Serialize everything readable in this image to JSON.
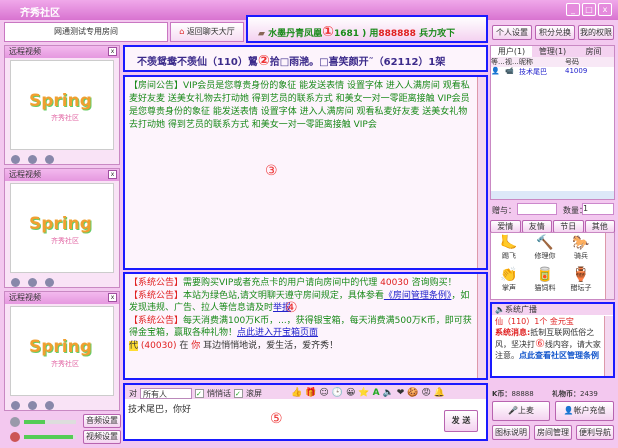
{
  "window": {
    "title": "齐秀社区",
    "min": "_",
    "max": "□",
    "close": "x"
  },
  "tabs": {
    "room": "网通测试专用房间",
    "back": "返回聊天大厅"
  },
  "marquee1": {
    "text": "水墨丹青凤凰",
    "mid": "(",
    "tail": "1681 ) 用",
    "amount": "888888",
    "end": " 兵力攻下",
    "marker": "①"
  },
  "marquee2": {
    "a": "不羡鸳鸯不羡仙（110）鶦",
    "marker": "②",
    "b": "拾□雨滟。□喜笑颜开˜（62112）1架"
  },
  "top_buttons": [
    "个人设置",
    "积分兑换",
    "我的权限"
  ],
  "video_panels": [
    {
      "title": "远程视频",
      "logo": "Spring",
      "sub": "齐秀社区"
    },
    {
      "title": "远程视频",
      "logo": "Spring",
      "sub": "齐秀社区"
    },
    {
      "title": "远程视频",
      "logo": "Spring",
      "sub": "齐秀社区"
    }
  ],
  "announcement": {
    "tag": "【房间公告】",
    "text": "VIP会员是您尊贵身份的象征 能发送表情 设置字体 进入人满房间 观看私麦好友麦 送美女礼物去打动她 得到艺员的联系方式 和美女一对一零距离接触 VIP会员是您尊贵身份的象征 能发送表情 设置字体 进入人满房间 观看私麦好友麦 送美女礼物去打动她 得到艺员的联系方式 和美女一对一零距离接触 VIP会",
    "marker": "③"
  },
  "messages": {
    "m1": {
      "tag": "【系统公告】",
      "text": "需要购买VIP或者充点卡的用户请向房间中的代理 ",
      "num": "40030",
      "tail": " 咨询购买！"
    },
    "m2": {
      "tag": "【系统公告】",
      "text": "本站为绿色站,请文明聊天遵守房间规定，具体参看",
      "link": "《房间管理条例》",
      "tail": "，如发现违规、广告、拉人等信息请及时",
      "link2": "举报"
    },
    "m3": {
      "tag": "【系统公告】",
      "text": "每天消费满100万K币，...，获得银宝箱，每天消费满500万K币，即可获得金宝箱，赢取各种礼物！",
      "link": "点此进入开宝箱页面"
    },
    "m4": {
      "badge": "代",
      "from": "(40030)",
      "at": " 在 ",
      "you": "你",
      "text": " 耳边悄悄地说，爱生活，爱齐秀！"
    },
    "marker": "④"
  },
  "input": {
    "to_label": "对",
    "to_value": "所有人",
    "whisper": "悄悄话",
    "scroll": "滚屏",
    "text": "技术尾巴，你好",
    "send": "发 送",
    "marker": "⑤"
  },
  "audio": {
    "audio_btn": "音频设置",
    "video_btn": "视频设置",
    "audio_level": 0.4,
    "video_level": 0.95
  },
  "users": {
    "tabs": [
      "用户(1)",
      "管理(1)",
      "房间"
    ],
    "cols": [
      "等...",
      "视...",
      "昵称",
      "号码"
    ],
    "rows": [
      {
        "name": "技术尾巴",
        "id": "41009"
      }
    ]
  },
  "gift": {
    "give_label": "赠与：",
    "qty_label": "数量：",
    "qty": "1",
    "tabs": [
      "爱情",
      "友情",
      "节日",
      "其他"
    ],
    "items": [
      "踢飞",
      "修理你",
      "骑兵",
      "掌声",
      "猫饲料",
      "醋坛子"
    ]
  },
  "broadcast": {
    "title": "系统广播",
    "l1": "仙（110）1个 金元宝",
    "tag": "系统消息:",
    "text": "抵制互联网低俗之风，坚决打",
    "marker": "⑥",
    "text2": "线内容，请大家注意。",
    "link": "点此查看社区管理条例"
  },
  "account": {
    "k_label": "K币：",
    "k": "88888",
    "gift_label": "礼物币：",
    "gift": "2439"
  },
  "bottom_buttons": {
    "mic": "上麦",
    "recharge": "帐户充值",
    "b1": "图标说明",
    "b2": "房间管理",
    "b3": "便利导航"
  }
}
